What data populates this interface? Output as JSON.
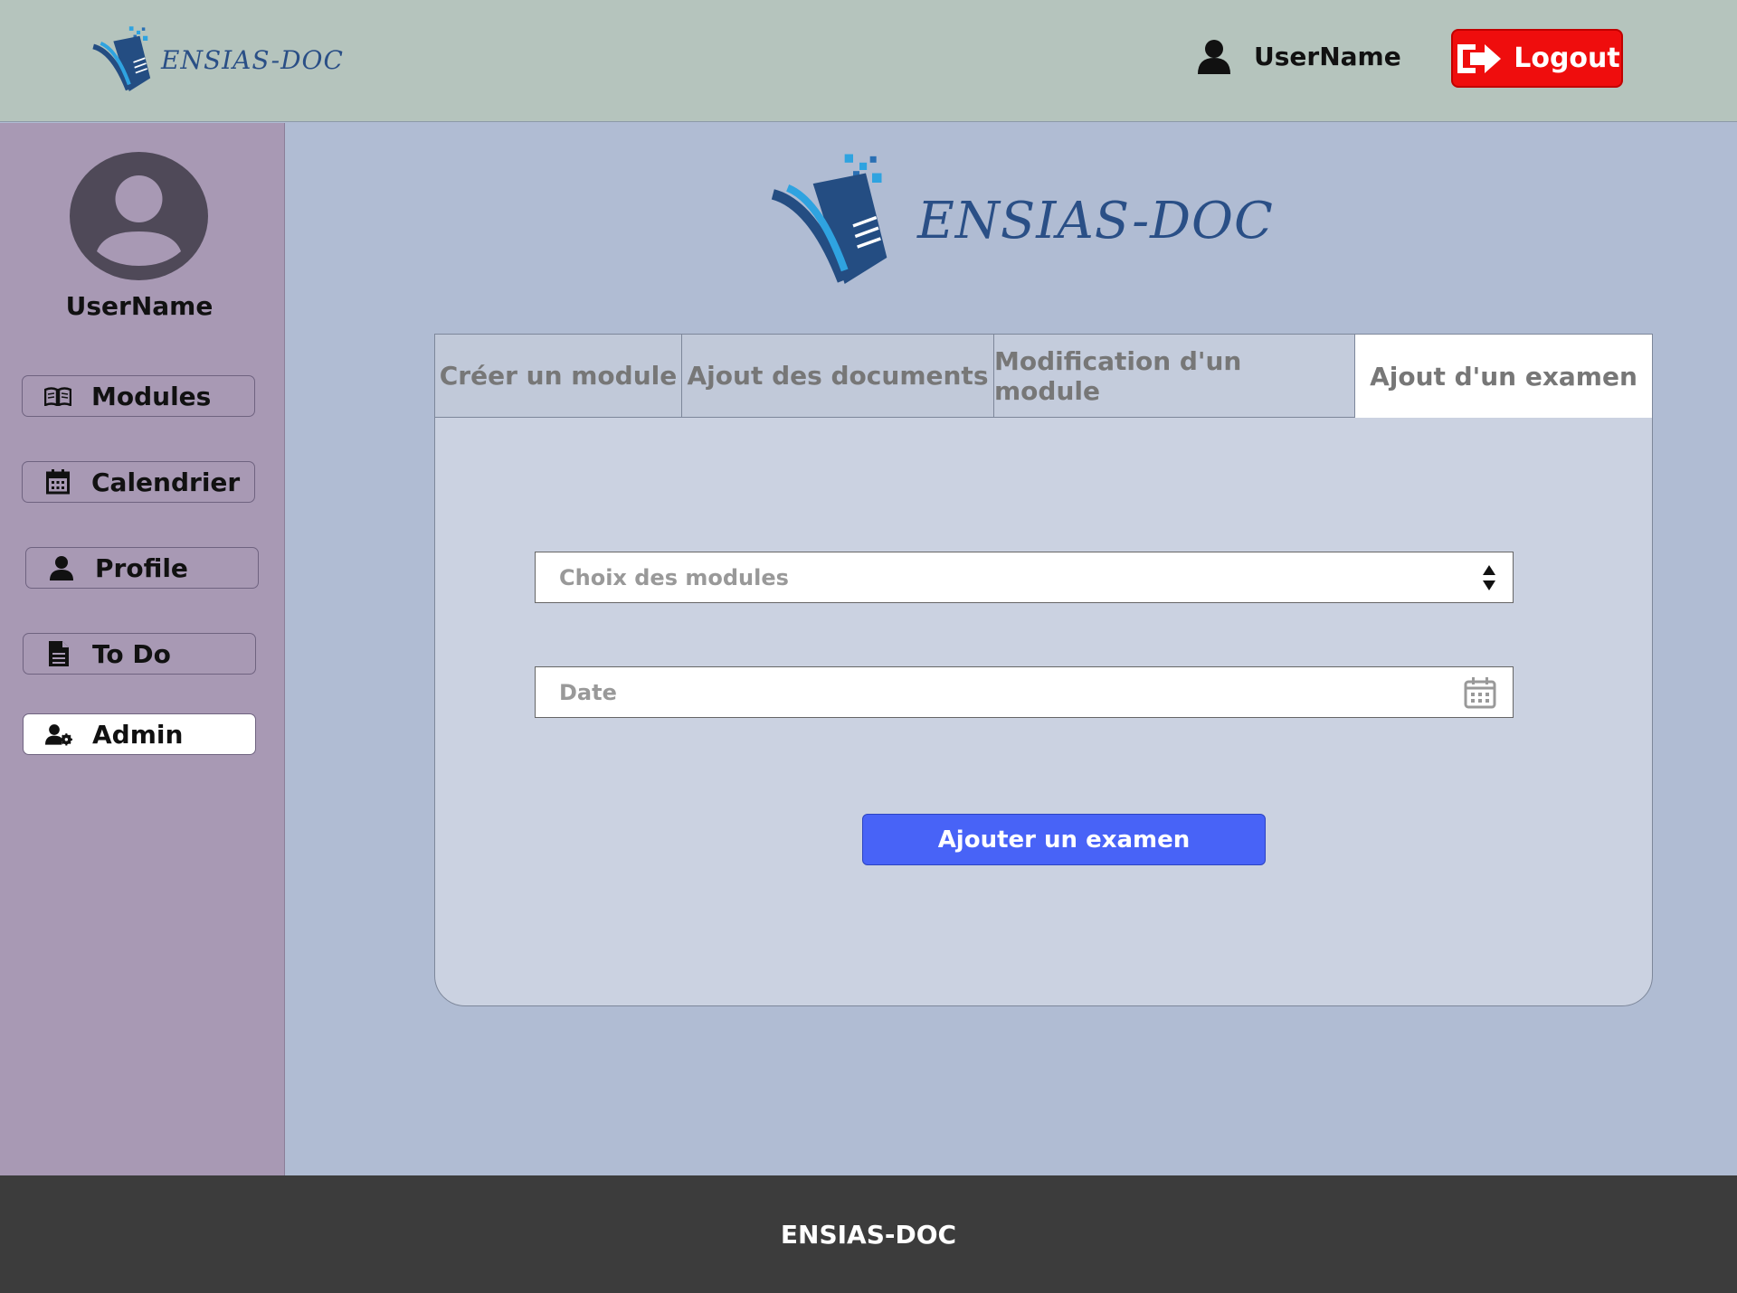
{
  "header": {
    "brand": "ENSIAS-DOC",
    "username": "UserName",
    "logout_label": "Logout",
    "logout_color": "#ef0d0d"
  },
  "sidebar": {
    "username": "UserName",
    "items": [
      {
        "label": "Modules",
        "icon": "book-open-icon",
        "active": false
      },
      {
        "label": "Calendrier",
        "icon": "calendar-icon",
        "active": false
      },
      {
        "label": "Profile",
        "icon": "user-icon",
        "active": false
      },
      {
        "label": "To Do",
        "icon": "document-icon",
        "active": false
      },
      {
        "label": "Admin",
        "icon": "user-gear-icon",
        "active": true
      }
    ]
  },
  "main": {
    "brand": "ENSIAS-DOC",
    "tabs": [
      {
        "label": "Créer un module",
        "active": false
      },
      {
        "label": "Ajout des documents",
        "active": false
      },
      {
        "label": "Modification d'un module",
        "active": false
      },
      {
        "label": "Ajout d'un examen",
        "active": true
      }
    ],
    "form": {
      "module_select_placeholder": "Choix des modules",
      "date_placeholder": "Date",
      "submit_label": "Ajouter un examen",
      "submit_color": "#4863f7"
    }
  },
  "footer": {
    "text": "ENSIAS-DOC"
  }
}
